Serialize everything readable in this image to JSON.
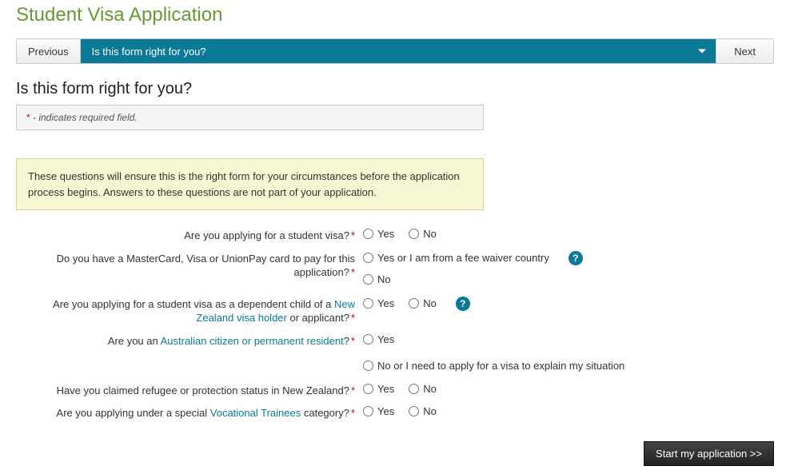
{
  "page": {
    "title": "Student Visa Application"
  },
  "nav": {
    "prev": "Previous",
    "current": "Is this form right for you?",
    "next": "Next"
  },
  "section": {
    "heading": "Is this form right for you?",
    "required_note_prefix": "*",
    "required_note_text": " - indicates required field."
  },
  "info_box": {
    "text": "These questions will ensure this is the right form for your circumstances before the application process begins. Answers to these questions are not part of your application."
  },
  "questions": {
    "q1": {
      "label": "Are you applying for a student visa?",
      "yes": "Yes",
      "no": "No"
    },
    "q2": {
      "label_pre": "Do you have a MasterCard, Visa or UnionPay card to pay for this application?",
      "opt1": "Yes or I am from a fee waiver country",
      "opt2": "No"
    },
    "q3": {
      "label_pre": "Are you applying for a student visa as a dependent child of a ",
      "link": "New Zealand visa holder",
      "label_post": " or applicant?",
      "yes": "Yes",
      "no": "No"
    },
    "q4": {
      "label_pre": "Are you an ",
      "link": "Australian citizen or permanent resident",
      "label_post": "?",
      "opt1": "Yes",
      "opt2": "No or I need to apply for a visa to explain my situation"
    },
    "q5": {
      "label": "Have you claimed refugee or protection status in New Zealand?",
      "yes": "Yes",
      "no": "No"
    },
    "q6": {
      "label_pre": "Are you applying under a special ",
      "link": "Vocational Trainees",
      "label_post": " category?",
      "yes": "Yes",
      "no": "No"
    }
  },
  "actions": {
    "start": "Start my application >>"
  },
  "help_icon": "?"
}
